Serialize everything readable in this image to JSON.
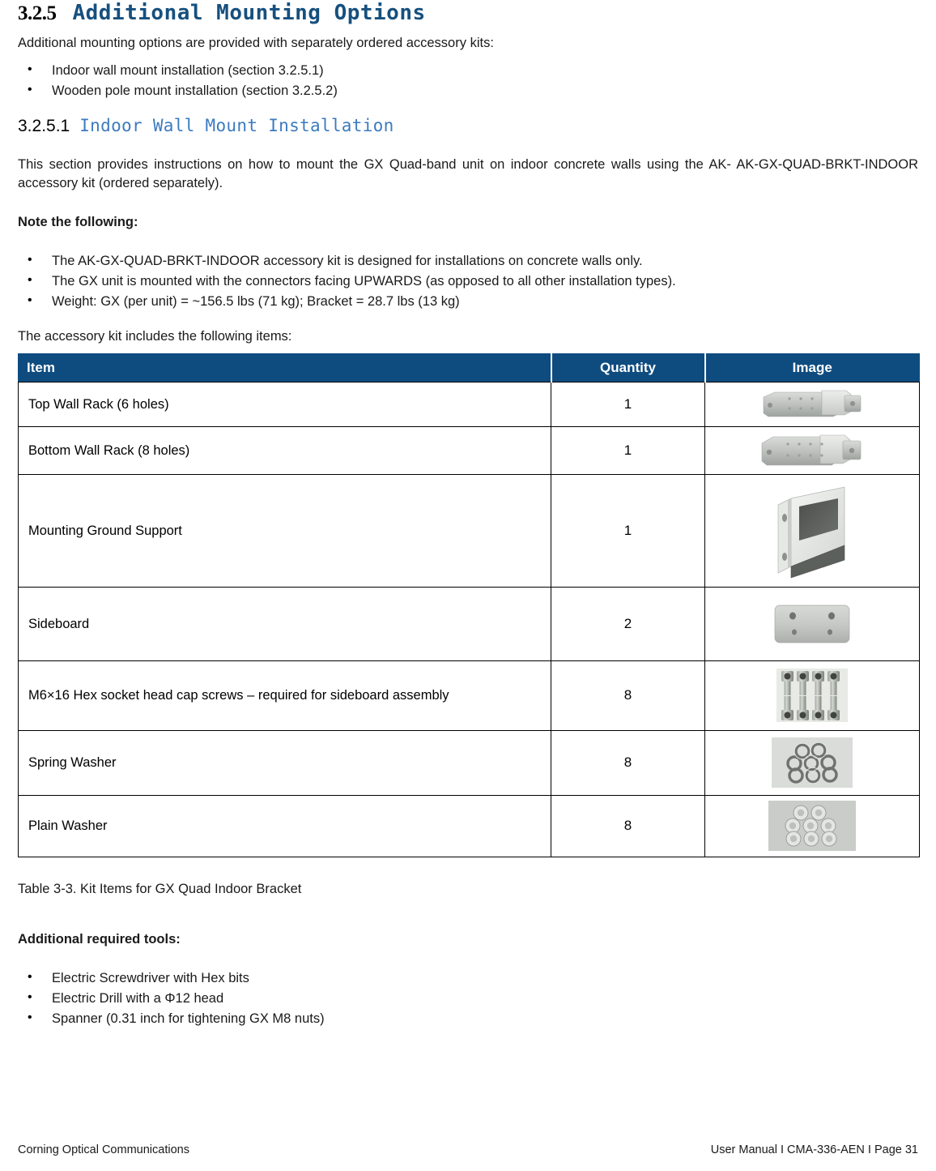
{
  "heading": {
    "section_number": "3.2.5",
    "section_title": "Additional Mounting Options",
    "subsection_number": "3.2.5.1",
    "subsection_title": "Indoor Wall Mount Installation"
  },
  "intro": {
    "lead": "Additional mounting options are provided with separately ordered accessory kits:",
    "options": [
      "Indoor wall mount installation (section 3.2.5.1)",
      "Wooden pole mount installation (section 3.2.5.2)"
    ]
  },
  "body": {
    "description": "This section provides instructions on how to mount the GX Quad-band unit on indoor concrete walls using the AK- AK-GX-QUAD-BRKT-INDOOR accessory kit (ordered separately).",
    "note_label": "Note the following:",
    "notes": [
      "The AK-GX-QUAD-BRKT-INDOOR accessory kit is designed for installations on concrete walls only.",
      "The GX unit is mounted with the connectors facing UPWARDS (as opposed to all other installation types).",
      "Weight: GX (per unit) =  ~156.5 lbs (71 kg); Bracket = 28.7 lbs (13 kg)"
    ],
    "kit_intro": "The accessory kit includes the following items:"
  },
  "table": {
    "headers": [
      "Item",
      "Quantity",
      "Image"
    ],
    "header_bg": "#0E4C80",
    "rows": [
      {
        "item": "Top Wall Rack (6 holes)",
        "quantity": "1",
        "image": "top-wall-rack-photo"
      },
      {
        "item": "Bottom Wall Rack (8 holes)",
        "quantity": "1",
        "image": "bottom-wall-rack-photo"
      },
      {
        "item": "Mounting Ground Support",
        "quantity": "1",
        "image": "mounting-ground-support-photo"
      },
      {
        "item": "Sideboard",
        "quantity": "2",
        "image": "sideboard-photo"
      },
      {
        "item": "M6×16 Hex socket head cap screws – required for sideboard assembly",
        "quantity": "8",
        "image": "hex-cap-screws-photo"
      },
      {
        "item": "Spring Washer",
        "quantity": "8",
        "image": "spring-washer-photo"
      },
      {
        "item": "Plain Washer",
        "quantity": "8",
        "image": "plain-washer-photo"
      }
    ],
    "caption": "Table 3-3. Kit Items for GX Quad Indoor Bracket"
  },
  "tools": {
    "label": "Additional required tools:",
    "items": [
      "Electric Screwdriver with Hex bits",
      "Electric Drill with a Φ12 head",
      "Spanner (0.31 inch for tightening GX M8 nuts)"
    ]
  },
  "footer": {
    "left": "Corning Optical Communications",
    "right": "User Manual I CMA-336-AEN I Page 31"
  }
}
